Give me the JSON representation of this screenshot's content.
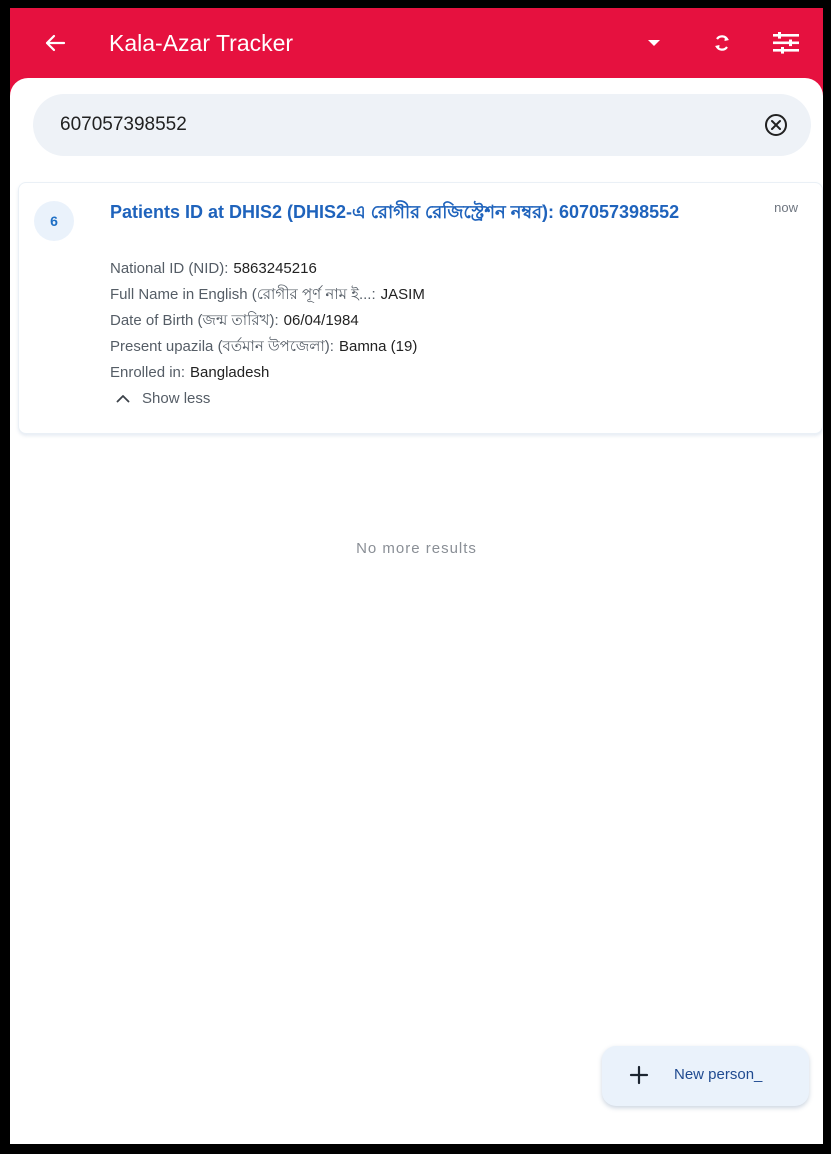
{
  "colors": {
    "app_bar": "#e6113f",
    "accent_blue": "#1f63bc",
    "search_bg": "#eef2f7"
  },
  "app_bar": {
    "title": "Kala-Azar Tracker",
    "icons": [
      "back-arrow-icon",
      "dropdown-caret-icon",
      "sync-icon",
      "filter-icon"
    ]
  },
  "search": {
    "value": "607057398552",
    "clear_icon": "clear-circle-icon"
  },
  "result": {
    "sync_badge": "6",
    "title": "Patients ID at DHIS2 (DHIS2-এ রোগীর রেজিস্ট্রেশন নম্বর): 607057398552",
    "time": "now",
    "attributes": [
      {
        "label": "National ID (NID):",
        "value": "5863245216"
      },
      {
        "label": "Full Name in English (রোগীর পূর্ণ নাম ই...:",
        "value": "JASIM"
      },
      {
        "label": "Date of Birth (জন্ম তারিখ):",
        "value": "06/04/1984"
      },
      {
        "label": "Present upazila (বর্তমান উপজেলা):",
        "value": "Bamna (19)"
      },
      {
        "label": "Enrolled in:",
        "value": "Bangladesh"
      }
    ],
    "show_less": "Show less"
  },
  "list_footer": "No more results",
  "fab": {
    "label": "New person_",
    "icon": "plus-icon"
  }
}
